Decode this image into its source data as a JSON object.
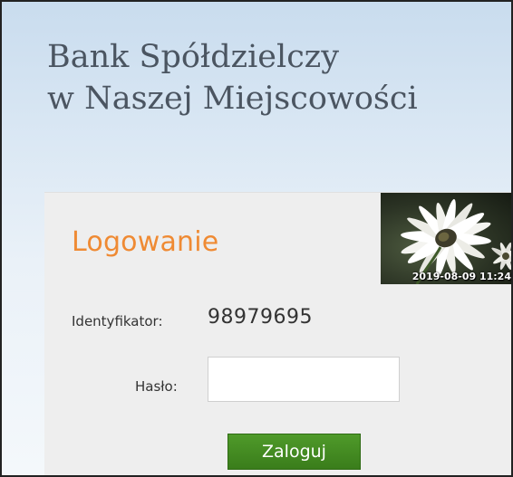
{
  "header": {
    "bank_name_line1": "Bank Spółdzielczy",
    "bank_name_line2": "w Naszej Miejscowości"
  },
  "login": {
    "title": "Logowanie",
    "identifier_label": "Identyfikator:",
    "identifier_value": "98979695",
    "password_label": "Hasło:",
    "password_value": "",
    "submit_label": "Zaloguj"
  },
  "security_image": {
    "icon": "daisy-flower-photo",
    "timestamp": "2019-08-09 11:24"
  },
  "colors": {
    "title_accent": "#ef8a33",
    "button_green": "#3a7d1b",
    "bank_name_text": "#4b5561"
  }
}
